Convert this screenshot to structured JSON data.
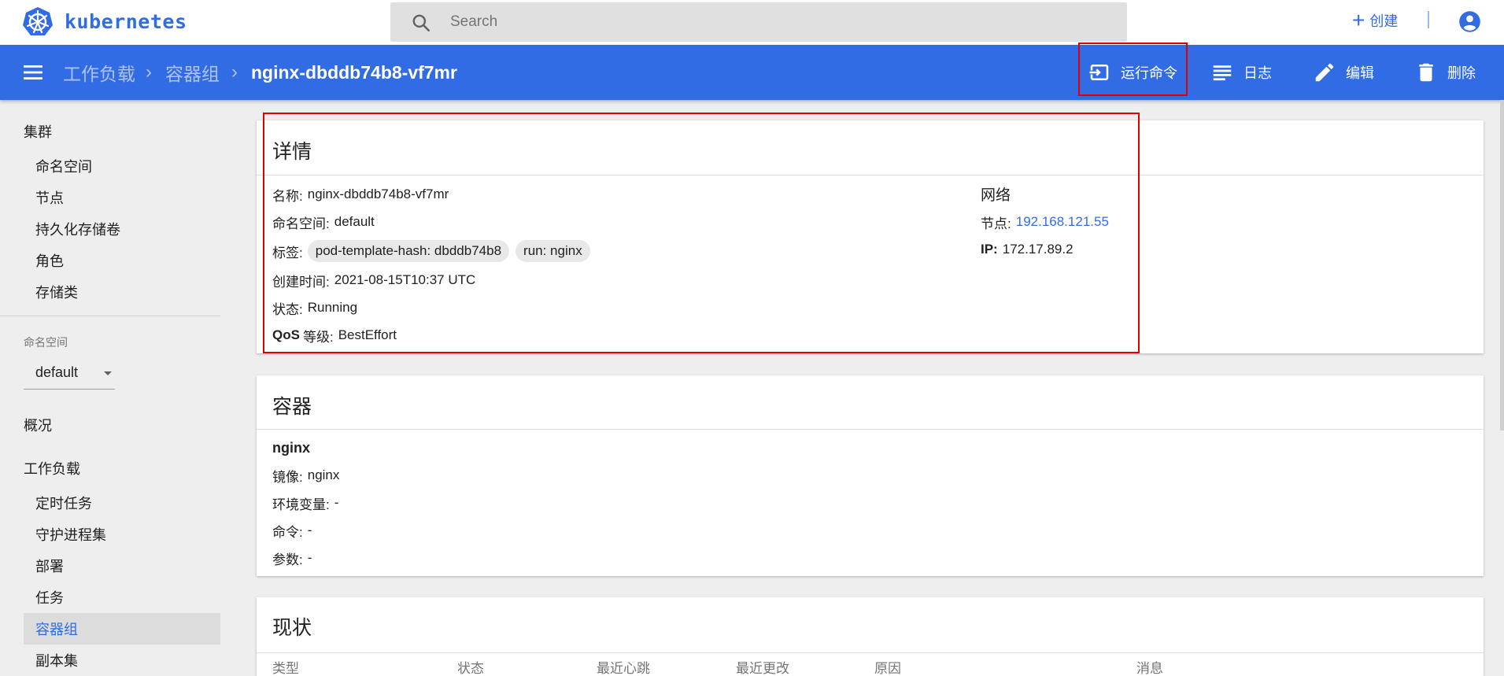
{
  "app": {
    "brand": "kubernetes"
  },
  "search": {
    "placeholder": "Search"
  },
  "header": {
    "create_label": "创建"
  },
  "breadcrumb": {
    "items": [
      "工作负载",
      "容器组"
    ],
    "current": "nginx-dbddb74b8-vf7mr"
  },
  "actions": {
    "exec": "运行命令",
    "logs": "日志",
    "edit": "编辑",
    "delete": "删除"
  },
  "sidebar": {
    "cluster": "集群",
    "cluster_items": [
      "命名空间",
      "节点",
      "持久化存储卷",
      "角色",
      "存储类"
    ],
    "namespace_label": "命名空间",
    "namespace_value": "default",
    "overview": "概况",
    "workloads": "工作负载",
    "workload_items": [
      "定时任务",
      "守护进程集",
      "部署",
      "任务",
      "容器组",
      "副本集"
    ],
    "active_item": "容器组"
  },
  "details": {
    "title": "详情",
    "name_key": "名称:",
    "name": "nginx-dbddb74b8-vf7mr",
    "namespace_key": "命名空间:",
    "namespace": "default",
    "labels_key": "标签:",
    "labels": [
      "pod-template-hash: dbddb74b8",
      "run: nginx"
    ],
    "created_key": "创建时间:",
    "created": "2021-08-15T10:37 UTC",
    "status_key": "状态:",
    "status": "Running",
    "qos_key_bold": "QoS",
    "qos_key": "等级:",
    "qos": "BestEffort",
    "network_title": "网络",
    "node_key": "节点:",
    "node": "192.168.121.55",
    "ip_key": "IP:",
    "ip": "172.17.89.2"
  },
  "containers": {
    "title": "容器",
    "name": "nginx",
    "image_key": "镜像:",
    "image": "nginx",
    "env_key": "环境变量:",
    "env": "-",
    "cmd_key": "命令:",
    "cmd": "-",
    "args_key": "参数:",
    "args": "-"
  },
  "conditions": {
    "title": "现状",
    "columns": [
      "类型",
      "状态",
      "最近心跳",
      "最近更改",
      "原因",
      "消息"
    ]
  },
  "colors": {
    "primary": "#326ce5",
    "highlight": "#e00000",
    "background": "#eeeeee"
  }
}
